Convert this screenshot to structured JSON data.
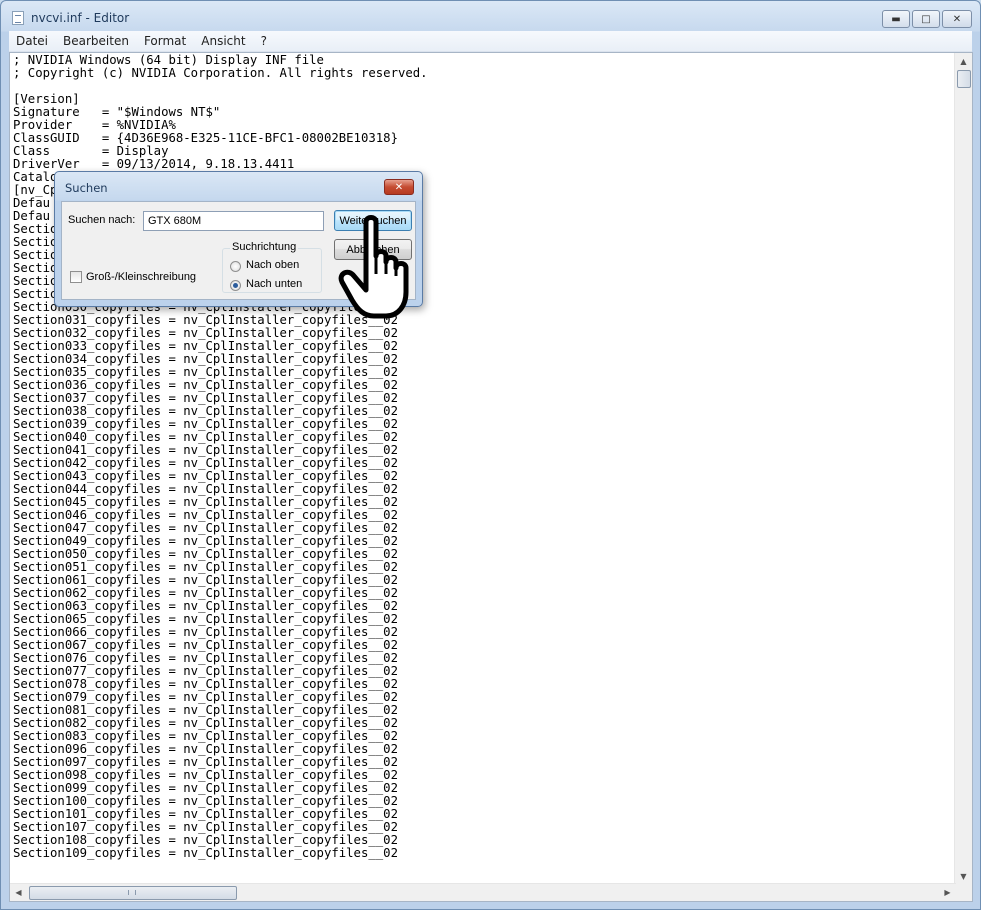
{
  "window": {
    "title": "nvcvi.inf - Editor",
    "minimize_glyph": "▬",
    "maximize_glyph": "□",
    "close_glyph": "✕"
  },
  "menu": [
    "Datei",
    "Bearbeiten",
    "Format",
    "Ansicht",
    "?"
  ],
  "editor_lines": [
    "; NVIDIA Windows (64 bit) Display INF file",
    "; Copyright (c) NVIDIA Corporation. All rights reserved.",
    "",
    "[Version]",
    "Signature   = \"$Windows NT$\"",
    "Provider    = %NVIDIA%",
    "ClassGUID   = {4D36E968-E325-11CE-BFC1-08002BE10318}",
    "Class       = Display",
    "DriverVer   = 09/13/2014, 9.18.13.4411",
    "Catalo",
    "[nv_Cp",
    "Defau",
    "Defau",
    "Sectio                                          _02",
    "Sectio                                          _02",
    "Sectio",
    "Sectio",
    "Sectio",
    "Sectio",
    "Section030_copyfiles = nv_CplInstaller_copyfiles__02",
    "Section031_copyfiles = nv_CplInstaller_copyfiles__02",
    "Section032_copyfiles = nv_CplInstaller_copyfiles__02",
    "Section033_copyfiles = nv_CplInstaller_copyfiles__02",
    "Section034_copyfiles = nv_CplInstaller_copyfiles__02",
    "Section035_copyfiles = nv_CplInstaller_copyfiles__02",
    "Section036_copyfiles = nv_CplInstaller_copyfiles__02",
    "Section037_copyfiles = nv_CplInstaller_copyfiles__02",
    "Section038_copyfiles = nv_CplInstaller_copyfiles__02",
    "Section039_copyfiles = nv_CplInstaller_copyfiles__02",
    "Section040_copyfiles = nv_CplInstaller_copyfiles__02",
    "Section041_copyfiles = nv_CplInstaller_copyfiles__02",
    "Section042_copyfiles = nv_CplInstaller_copyfiles__02",
    "Section043_copyfiles = nv_CplInstaller_copyfiles__02",
    "Section044_copyfiles = nv_CplInstaller_copyfiles__02",
    "Section045_copyfiles = nv_CplInstaller_copyfiles__02",
    "Section046_copyfiles = nv_CplInstaller_copyfiles__02",
    "Section047_copyfiles = nv_CplInstaller_copyfiles__02",
    "Section049_copyfiles = nv_CplInstaller_copyfiles__02",
    "Section050_copyfiles = nv_CplInstaller_copyfiles__02",
    "Section051_copyfiles = nv_CplInstaller_copyfiles__02",
    "Section061_copyfiles = nv_CplInstaller_copyfiles__02",
    "Section062_copyfiles = nv_CplInstaller_copyfiles__02",
    "Section063_copyfiles = nv_CplInstaller_copyfiles__02",
    "Section065_copyfiles = nv_CplInstaller_copyfiles__02",
    "Section066_copyfiles = nv_CplInstaller_copyfiles__02",
    "Section067_copyfiles = nv_CplInstaller_copyfiles__02",
    "Section076_copyfiles = nv_CplInstaller_copyfiles__02",
    "Section077_copyfiles = nv_CplInstaller_copyfiles__02",
    "Section078_copyfiles = nv_CplInstaller_copyfiles__02",
    "Section079_copyfiles = nv_CplInstaller_copyfiles__02",
    "Section081_copyfiles = nv_CplInstaller_copyfiles__02",
    "Section082_copyfiles = nv_CplInstaller_copyfiles__02",
    "Section083_copyfiles = nv_CplInstaller_copyfiles__02",
    "Section096_copyfiles = nv_CplInstaller_copyfiles__02",
    "Section097_copyfiles = nv_CplInstaller_copyfiles__02",
    "Section098_copyfiles = nv_CplInstaller_copyfiles__02",
    "Section099_copyfiles = nv_CplInstaller_copyfiles__02",
    "Section100_copyfiles = nv_CplInstaller_copyfiles__02",
    "Section101_copyfiles = nv_CplInstaller_copyfiles__02",
    "Section107_copyfiles = nv_CplInstaller_copyfiles__02",
    "Section108_copyfiles = nv_CplInstaller_copyfiles__02",
    "Section109_copyfiles = nv_CplInstaller_copyfiles__02"
  ],
  "find_dialog": {
    "title": "Suchen",
    "close_glyph": "✕",
    "search_label": "Suchen nach:",
    "search_value": "GTX 680M",
    "find_next_label": "Weitersuchen",
    "cancel_label": "Abbrechen",
    "direction_group_label": "Suchrichtung",
    "direction_up_label": "Nach oben",
    "direction_down_label": "Nach unten",
    "direction_selected": "down",
    "match_case_label": "Groß-/Kleinschreibung",
    "match_case_checked": false
  },
  "scrollbars": {
    "up_glyph": "▲",
    "down_glyph": "▼",
    "left_glyph": "◀",
    "right_glyph": "▶"
  }
}
